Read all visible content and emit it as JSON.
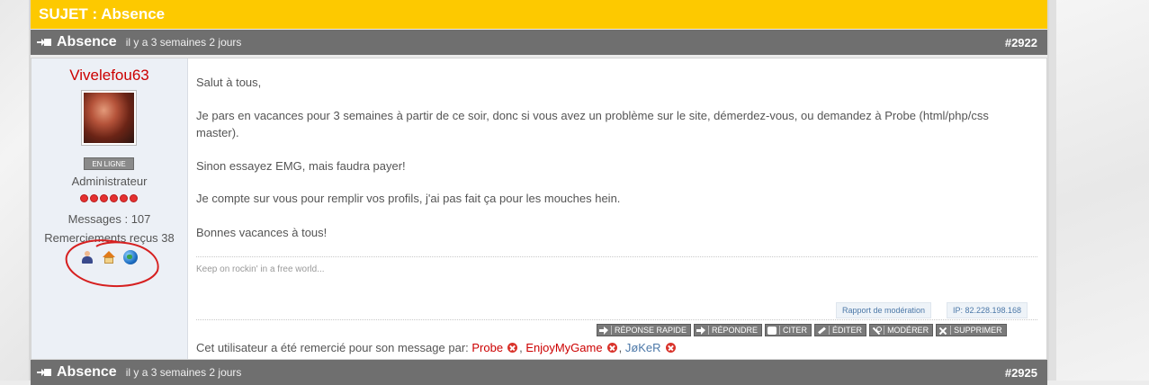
{
  "topic": {
    "title": "SUJET : Absence",
    "accent": "#fdc900"
  },
  "posts": [
    {
      "title": "Absence",
      "ago": "il y a 3 semaines 2 jours",
      "number": "#2922",
      "author": {
        "username": "Vivelefou63",
        "username_color": "#cc0000",
        "status": "EN LIGNE",
        "role": "Administrateur",
        "rank_dots": 6,
        "messages": "Messages : 107",
        "thanks_received": "Remerciements reçus 38",
        "icons": [
          "user-profile-icon",
          "home-icon",
          "website-icon"
        ]
      },
      "paragraphs": [
        "Salut à tous,",
        "Je pars en vacances pour 3 semaines à partir de ce soir, donc si vous avez un problème sur le site, démerdez-vous, ou demandez à Probe (html/php/css master).",
        "Sinon essayez EMG, mais faudra payer!",
        "Je compte sur vous pour remplir vos profils, j'ai pas fait ça pour les mouches hein.",
        "Bonnes vacances à tous!"
      ],
      "signature": "Keep on rockin' in a free world...",
      "moderation_report": "Rapport de modération",
      "ip": "IP: 82.228.198.168",
      "actions": [
        "RÉPONSE RAPIDE",
        "RÉPONDRE",
        "CITER",
        "ÉDITER",
        "MODÉRER",
        "SUPPRIMER"
      ],
      "thanked_by_label": "Cet utilisateur a été remercié pour son message par:",
      "thanked_by": [
        {
          "name": "Probe",
          "color": "#cc0000"
        },
        {
          "name": "EnjoyMyGame",
          "color": "#cc0000"
        },
        {
          "name": "JøKeR",
          "color": "#4c78a8"
        }
      ]
    },
    {
      "title": "Absence",
      "ago": "il y a 3 semaines 2 jours",
      "number": "#2925"
    }
  ]
}
